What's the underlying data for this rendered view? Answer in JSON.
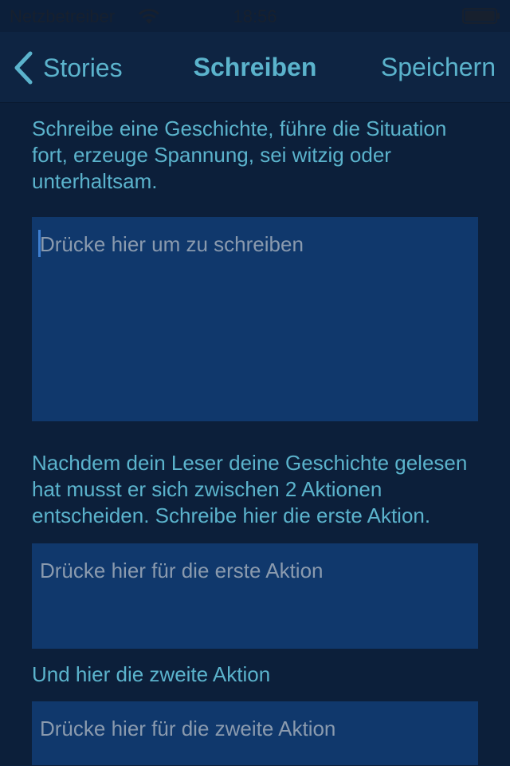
{
  "status_bar": {
    "carrier": "Netzbetreiber",
    "time": "18:56",
    "wifi_icon": "wifi-icon",
    "battery_icon": "battery-icon"
  },
  "nav": {
    "back_label": "Stories",
    "title": "Schreiben",
    "save_label": "Speichern"
  },
  "story": {
    "instruction": "Schreibe eine Geschichte, führe die Situation fort, erzeuge Spannung, sei witzig oder unterhaltsam.",
    "placeholder": "Drücke hier um zu schreiben"
  },
  "action1": {
    "instruction": "Nachdem dein Leser deine Geschichte gelesen hat musst er sich zwischen 2 Aktionen entscheiden. Schreibe hier die erste Aktion.",
    "placeholder": "Drücke hier für die erste Aktion"
  },
  "action2": {
    "instruction": "Und hier die zweite Aktion",
    "placeholder": "Drücke hier für die zweite Aktion"
  },
  "colors": {
    "background": "#0c1f3a",
    "accent": "#5bb3cc",
    "field": "#10386c",
    "placeholder": "#8a9aae"
  }
}
